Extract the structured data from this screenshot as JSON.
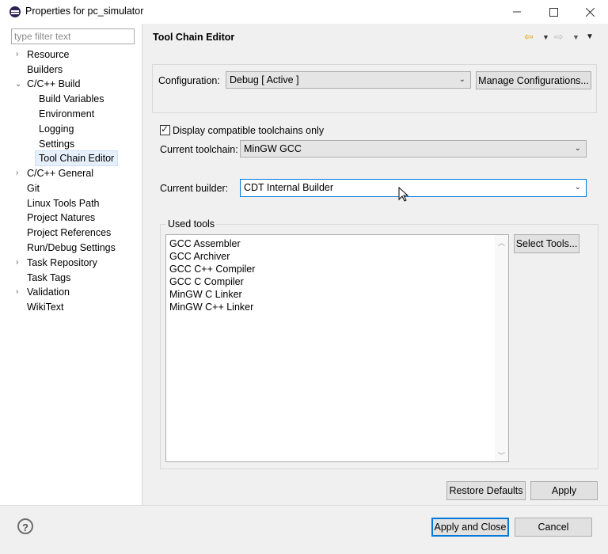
{
  "window": {
    "title": "Properties for pc_simulator",
    "minimize_icon": "minimize-icon",
    "maximize_icon": "maximize-icon",
    "close_icon": "close-icon"
  },
  "sidebar": {
    "filter_placeholder": "type filter text",
    "items": [
      {
        "label": "Resource",
        "expandable": true
      },
      {
        "label": "Builders"
      },
      {
        "label": "C/C++ Build",
        "expanded": true
      },
      {
        "label": "Build Variables",
        "child": true
      },
      {
        "label": "Environment",
        "child": true
      },
      {
        "label": "Logging",
        "child": true
      },
      {
        "label": "Settings",
        "child": true
      },
      {
        "label": "Tool Chain Editor",
        "child": true,
        "selected": true
      },
      {
        "label": "C/C++ General",
        "expandable": true
      },
      {
        "label": "Git"
      },
      {
        "label": "Linux Tools Path"
      },
      {
        "label": "Project Natures"
      },
      {
        "label": "Project References"
      },
      {
        "label": "Run/Debug Settings"
      },
      {
        "label": "Task Repository",
        "expandable": true
      },
      {
        "label": "Task Tags"
      },
      {
        "label": "Validation",
        "expandable": true
      },
      {
        "label": "WikiText"
      }
    ]
  },
  "header": {
    "title": "Tool Chain Editor",
    "nav_icons": [
      "back-arrow-icon",
      "dropdown-icon",
      "forward-arrow-icon",
      "dropdown-icon",
      "view-menu-icon"
    ]
  },
  "configuration": {
    "label": "Configuration:",
    "value": "Debug  [ Active ]",
    "manage_button": "Manage Configurations..."
  },
  "toolchain": {
    "checkbox_label": "Display compatible toolchains only",
    "checked": true,
    "current_toolchain_label": "Current toolchain:",
    "current_toolchain_value": "MinGW GCC",
    "current_builder_label": "Current builder:",
    "current_builder_value": "CDT Internal Builder"
  },
  "used_tools": {
    "label": "Used tools",
    "items": [
      "GCC Assembler",
      "GCC Archiver",
      "GCC C++ Compiler",
      "GCC C Compiler",
      "MinGW C Linker",
      "MinGW C++ Linker"
    ],
    "select_button": "Select Tools..."
  },
  "footer": {
    "restore_defaults": "Restore Defaults",
    "apply": "Apply",
    "apply_and_close": "Apply and Close",
    "cancel": "Cancel",
    "help_icon": "help-icon"
  },
  "colors": {
    "accent": "#0078d7",
    "selection": "#e5f0fb",
    "back_arrow": "#e8a317"
  }
}
